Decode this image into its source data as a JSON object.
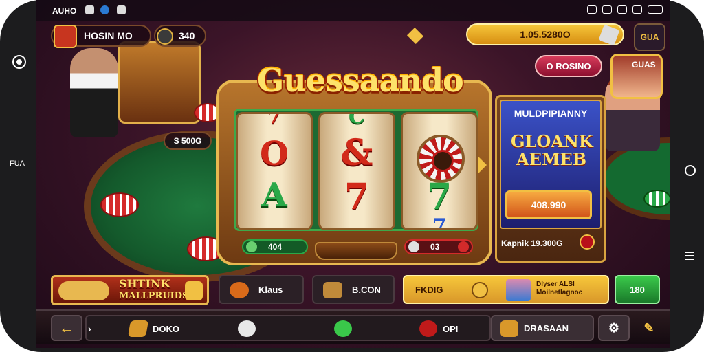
{
  "status_bar": {
    "time": "AUHO"
  },
  "side": {
    "label": "FUA"
  },
  "top": {
    "player_name": "HOSIN MO",
    "player_count": "340",
    "coins": "1.05.5280O",
    "square_label": "GUA",
    "rosino_label": "O ROSINO",
    "avatar_label": "GUAS"
  },
  "title": "Guessaando",
  "table": {
    "bet_label": "S 500G"
  },
  "slot": {
    "left_value": "404",
    "right_value": "03",
    "symbols": {
      "r1_top": "O",
      "r1_mid": "A",
      "r2_top": "&",
      "r2_mid": "7",
      "r3_mid": "7"
    }
  },
  "promo": {
    "title": "MULDPIPIANNY",
    "art_line1": "GLOANK",
    "art_line2": "AEMEB",
    "button": "408.990",
    "footer": "Kapnik 19.300G"
  },
  "row": {
    "logo_line1": "SHTINK",
    "logo_line2": "MALLPRUIDS",
    "klaus": "Klaus",
    "bcon": "B.CON",
    "gold_label": "FKDIG",
    "gold_desc": "Dlyser ALSI Moilnetlagnoc",
    "green": "180"
  },
  "bottom_nav": {
    "item1": "DOKO",
    "item3": "OPI",
    "dras": "DRASAAN"
  },
  "colors": {
    "gold": "#f1c043",
    "felt": "#1f7a3e",
    "accent_red": "#d22a1a"
  }
}
